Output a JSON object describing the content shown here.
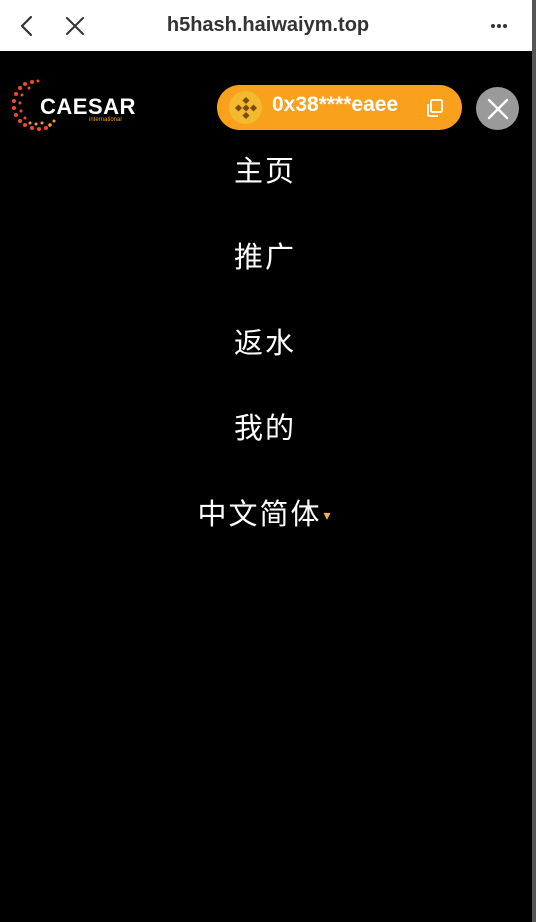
{
  "browser": {
    "url": "h5hash.haiwaiym.top",
    "back_icon": "chevron-left-icon",
    "close_icon": "close-icon",
    "more_icon": "more-dots-icon"
  },
  "header": {
    "logo": {
      "text": "CAESAR",
      "subtext": "international"
    },
    "wallet": {
      "address": "0x38****eaee",
      "coin_icon": "binance-coin-icon",
      "copy_icon": "copy-icon"
    },
    "menu_close_icon": "close-icon"
  },
  "menu": {
    "items": [
      {
        "label": "主页"
      },
      {
        "label": "推广"
      },
      {
        "label": "返水"
      },
      {
        "label": "我的"
      }
    ],
    "language": {
      "label": "中文简体",
      "caret": "▾"
    }
  },
  "colors": {
    "background": "#000000",
    "accent": "#F9A11C",
    "close_bg": "#9A9A9A",
    "coin": "#F3BA2F"
  }
}
